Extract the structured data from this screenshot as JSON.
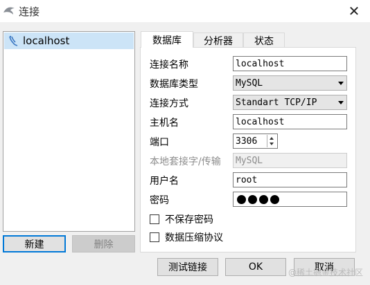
{
  "window": {
    "title": "连接",
    "close_glyph": "✕"
  },
  "connections": [
    {
      "name": "localhost"
    }
  ],
  "left_buttons": {
    "new": "新建",
    "delete": "删除"
  },
  "tabs": [
    {
      "label": "数据库",
      "active": true
    },
    {
      "label": "分析器"
    },
    {
      "label": "状态"
    }
  ],
  "form": {
    "connection_name": {
      "label": "连接名称",
      "value": "localhost"
    },
    "db_type": {
      "label": "数据库类型",
      "value": "MySQL"
    },
    "connection_method": {
      "label": "连接方式",
      "value": "Standart TCP/IP"
    },
    "hostname": {
      "label": "主机名",
      "value": "localhost"
    },
    "port": {
      "label": "端口",
      "value": "3306"
    },
    "local_socket": {
      "label": "本地套接字/传输",
      "value": "MySQL"
    },
    "username": {
      "label": "用户名",
      "value": "root"
    },
    "password": {
      "label": "密码",
      "masked_length": 4
    },
    "dont_save_password": {
      "label": "不保存密码",
      "checked": false
    },
    "compression": {
      "label": "数据压缩协议",
      "checked": false
    }
  },
  "bottom_buttons": {
    "test": "测试链接",
    "ok": "OK",
    "cancel": "取消"
  },
  "watermark": "@稀土掘金技术社区",
  "colors": {
    "selection": "#cce4f7",
    "accent": "#0078d7"
  }
}
